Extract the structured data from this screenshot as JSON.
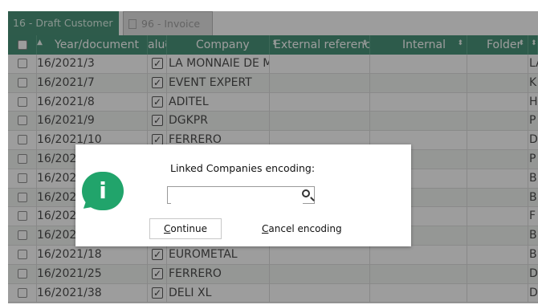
{
  "tabs": [
    {
      "label": "16 - Draft Customer"
    },
    {
      "label": "96 - Invoice"
    }
  ],
  "table": {
    "columns": [
      {
        "label": "Year/document"
      },
      {
        "label": "alue"
      },
      {
        "label": "Company"
      },
      {
        "label": "External reference"
      },
      {
        "label": "Internal"
      },
      {
        "label": "Folder"
      }
    ],
    "rows": [
      {
        "doc": "16/2021/3",
        "checked": true,
        "company": "LA MONNAIE DE M",
        "folder": "LA"
      },
      {
        "doc": "16/2021/7",
        "checked": true,
        "company": "EVENT EXPERT",
        "folder": "K"
      },
      {
        "doc": "16/2021/8",
        "checked": true,
        "company": "ADITEL",
        "folder": "H"
      },
      {
        "doc": "16/2021/9",
        "checked": true,
        "company": "DGKPR",
        "folder": "P"
      },
      {
        "doc": "16/2021/10",
        "checked": true,
        "company": "FERRERO",
        "folder": "D"
      },
      {
        "doc": "16/202",
        "checked": false,
        "company": "",
        "folder": "P"
      },
      {
        "doc": "16/202",
        "checked": false,
        "company": "",
        "folder": "B"
      },
      {
        "doc": "16/202",
        "checked": false,
        "company": "",
        "folder": "B"
      },
      {
        "doc": "16/202",
        "checked": false,
        "company": "",
        "folder": "F"
      },
      {
        "doc": "16/202",
        "checked": false,
        "company": "",
        "folder": "B"
      },
      {
        "doc": "16/2021/18",
        "checked": true,
        "company": "EUROMETAL",
        "folder": "B"
      },
      {
        "doc": "16/2021/25",
        "checked": true,
        "company": "FERRERO",
        "folder": "D"
      },
      {
        "doc": "16/2021/38",
        "checked": true,
        "company": "DELI XL",
        "folder": "D"
      }
    ]
  },
  "dialog": {
    "title": "Linked Companies encoding:",
    "search_value": "",
    "continue_label": "Continue",
    "cancel_label": "Cancel encoding",
    "info_icon_glyph": "i",
    "info_color": "#21a46b"
  },
  "colors": {
    "header_bg": "#1f7a5a",
    "tab_active_bg": "#207a5a"
  }
}
